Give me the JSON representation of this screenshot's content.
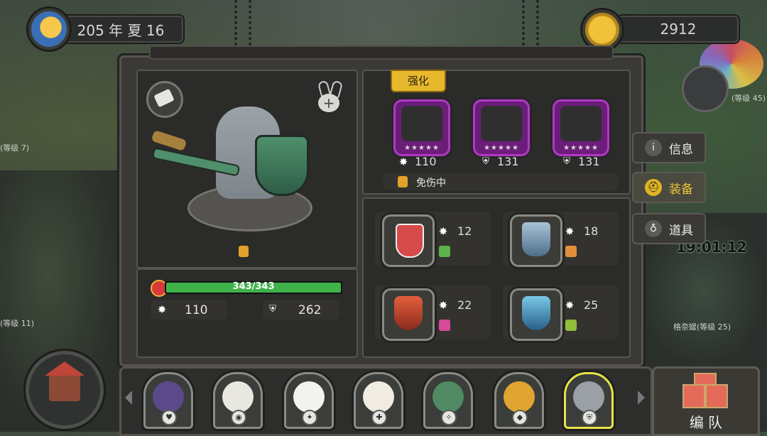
{
  "top": {
    "date_text": "205 年 夏 16",
    "gold_amount": "2912"
  },
  "background": {
    "clock_text": "19:01:12",
    "labels": [
      "(等级 45)",
      "(等级 7)",
      "(等级 11)",
      "格奈媞(等级 25)"
    ]
  },
  "hero": {
    "hp_text": "343/343",
    "hp_fraction": 1.0,
    "attack": "110",
    "defense": "262"
  },
  "equipment": {
    "enhance_label": "强化",
    "items": [
      {
        "stat_icon": "burst-icon",
        "value": "110"
      },
      {
        "stat_icon": "shield-icon",
        "value": "131"
      },
      {
        "stat_icon": "shield-icon",
        "value": "131"
      }
    ],
    "status_text": "免伤中"
  },
  "gear_slots": [
    {
      "name": "shield-slot",
      "value": "12",
      "badge_color": "#5db34a"
    },
    {
      "name": "armor-slot",
      "value": "18",
      "badge_color": "#e0903a"
    },
    {
      "name": "crest-slot",
      "value": "22",
      "badge_color": "#d64a9a"
    },
    {
      "name": "sword-slot",
      "value": "25",
      "badge_color": "#8fbf3a"
    }
  ],
  "side_menu": [
    {
      "label": "信息",
      "icon": "info-icon",
      "active": false
    },
    {
      "label": "装备",
      "icon": "helmet-icon",
      "active": true
    },
    {
      "label": "道具",
      "icon": "potion-icon",
      "active": false
    }
  ],
  "roster": {
    "heroes": [
      {
        "name": "pirate-wolf",
        "color": "#5a4a8a",
        "selected": false
      },
      {
        "name": "eagle",
        "color": "#e8e8e0",
        "selected": false
      },
      {
        "name": "polar-bear",
        "color": "#f2f2ee",
        "selected": false
      },
      {
        "name": "sheep",
        "color": "#f0ece2",
        "selected": false
      },
      {
        "name": "crocodile",
        "color": "#4f8a63",
        "selected": false
      },
      {
        "name": "leopard",
        "color": "#e0a530",
        "selected": false
      },
      {
        "name": "elephant",
        "color": "#9aa0a6",
        "selected": true
      }
    ],
    "team_label": "编 队"
  },
  "colors": {
    "hp_bar": "#3fb24a",
    "epic_frame": "#b03ac3",
    "enhance_tab": "#e8b92e"
  }
}
